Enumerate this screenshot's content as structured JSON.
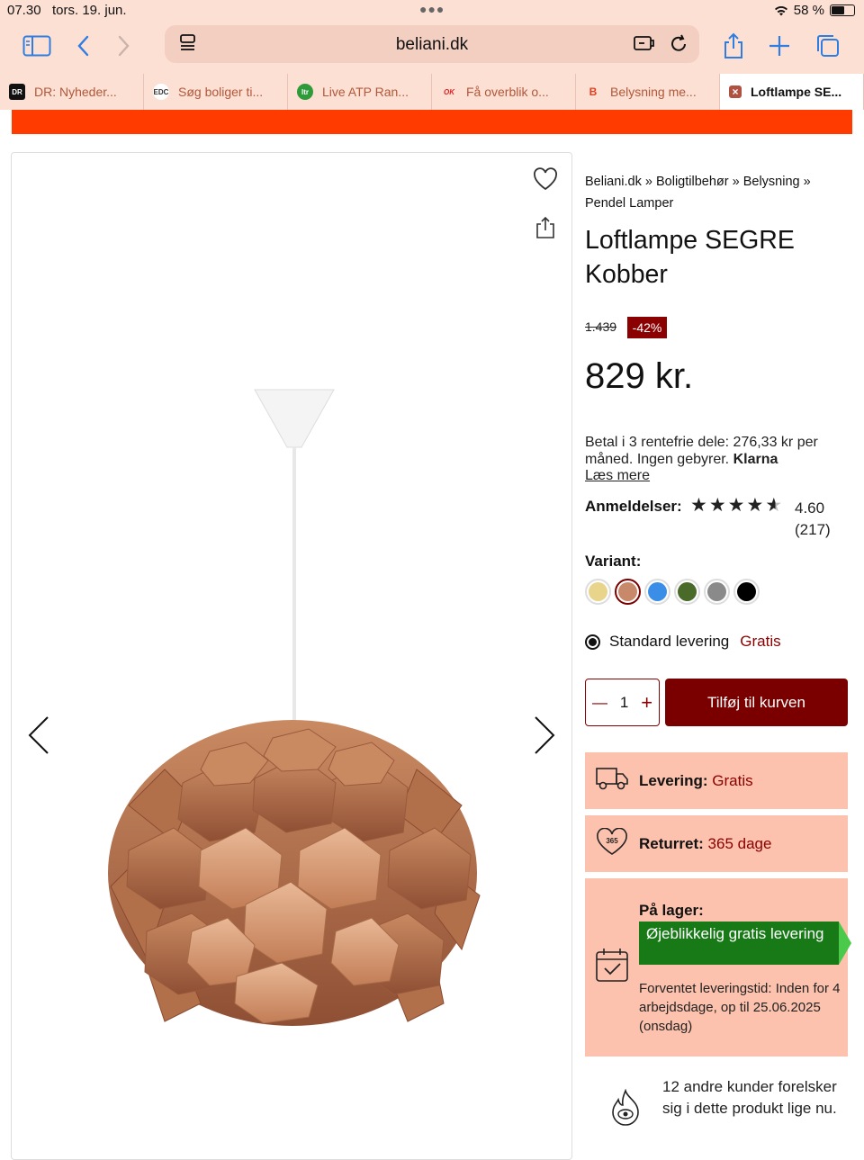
{
  "status_bar": {
    "time": "07.30",
    "date": "tors. 19. jun.",
    "battery": "58 %"
  },
  "browser": {
    "url": "beliani.dk",
    "tabs": [
      {
        "label": "DR: Nyheder...",
        "favicon": "DR",
        "fav_bg": "#111111",
        "fav_fg": "#ffffff"
      },
      {
        "label": "Søg boliger ti...",
        "favicon": "EDC",
        "fav_bg": "#ffffff",
        "fav_fg": "#333333"
      },
      {
        "label": "Live ATP Ran...",
        "favicon": "ltr",
        "fav_bg": "#2e9a3a",
        "fav_fg": "#ffffff"
      },
      {
        "label": "Få overblik o...",
        "favicon": "OK",
        "fav_bg": "#fde0d4",
        "fav_fg": "#e02020"
      },
      {
        "label": "Belysning me...",
        "favicon": "B",
        "fav_bg": "#fde0d4",
        "fav_fg": "#e04020"
      },
      {
        "label": "Loftlampe SE...",
        "favicon": "×",
        "fav_bg": "#b05040",
        "fav_fg": "#ffffff"
      }
    ]
  },
  "product": {
    "breadcrumb": "Beliani.dk » Boligtilbehør » Belysning » Pendel Lamper",
    "title": "Loftlampe SEGRE Kobber",
    "old_price": "1.439",
    "discount": "-42%",
    "price": "829 kr.",
    "klarna_text": "Betal i 3 rentefrie dele: 276,33 kr per måned. Ingen gebyrer.",
    "klarna_brand": "Klarna",
    "klarna_link": "Læs mere",
    "reviews_label": "Anmeldelser:",
    "rating_value": "4.60",
    "rating_count": "(217)",
    "rating": 4.6,
    "variant_label": "Variant:",
    "variants": [
      "#e8d48a",
      "#c8886a",
      "#3a8ee8",
      "#4a6a2a",
      "#8a8a8a",
      "#000000"
    ],
    "selected_variant": 1,
    "delivery_option": "Standard levering",
    "delivery_price": "Gratis",
    "quantity": "1",
    "add_to_cart": "Tilføj til kurven",
    "shipping_label": "Levering:",
    "shipping_value": "Gratis",
    "return_label": "Returret:",
    "return_value": "365 dage",
    "return_badge": "365",
    "stock_label": "På lager:",
    "stock_banner": "Øjeblikkelig gratis levering",
    "eta": "Forventet leveringstid: Inden for 4 arbejdsdage, op til 25.06.2025 (onsdag)",
    "social_proof": "12 andre kunder forelsker sig i dette produkt lige nu."
  },
  "colors": {
    "accent": "#7a0000",
    "banner": "#ff3b00",
    "info_box": "#fcc2ad",
    "lamp": "#b8714a"
  }
}
